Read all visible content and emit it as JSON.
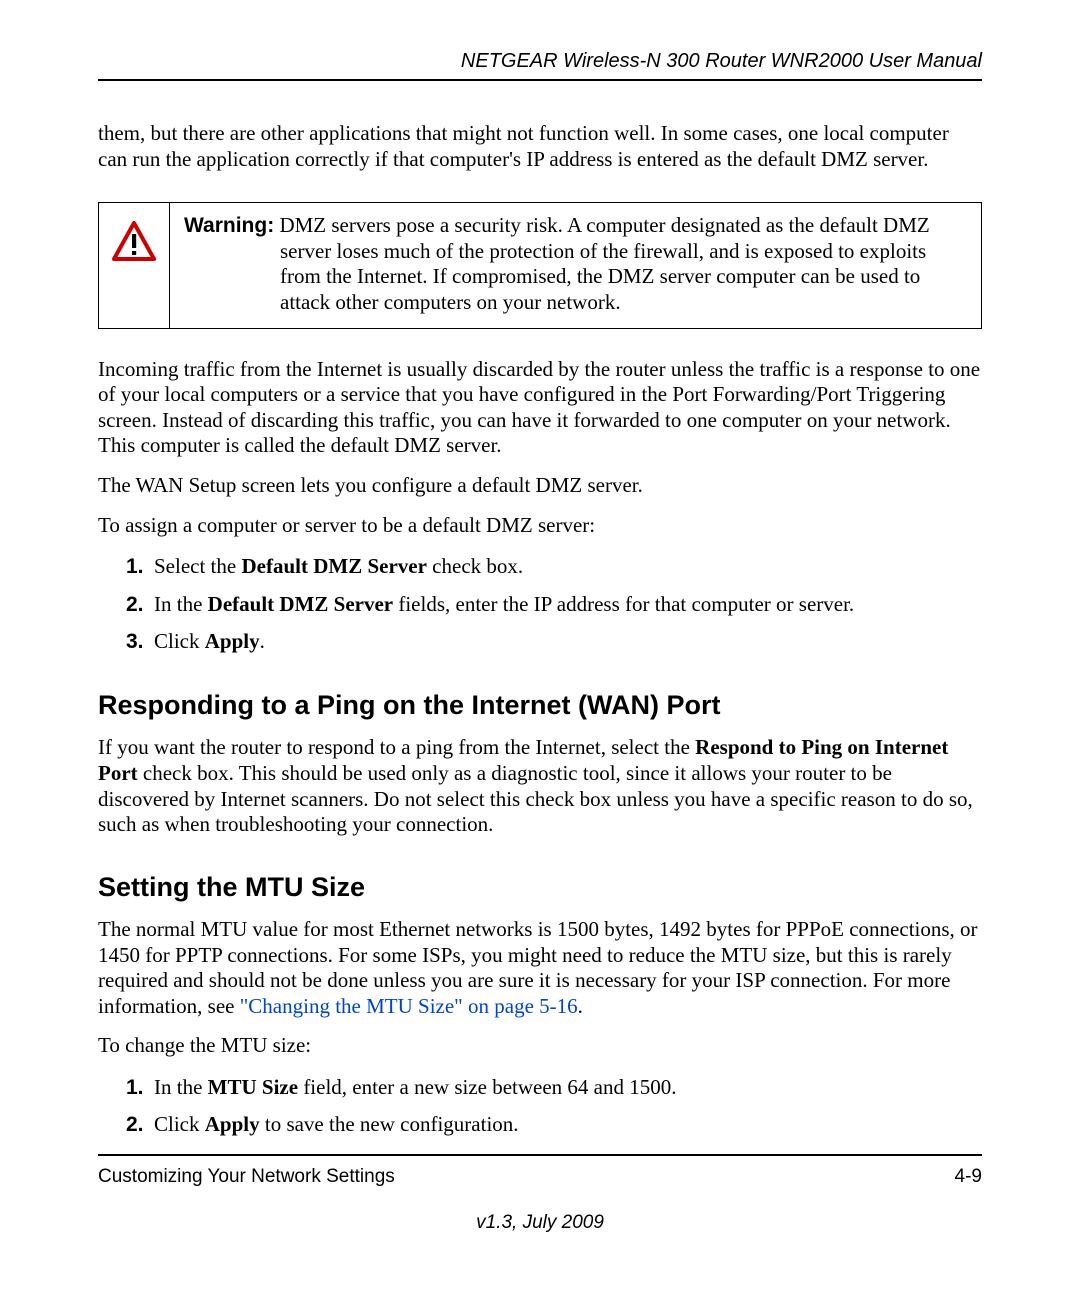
{
  "header": {
    "title": "NETGEAR Wireless-N 300 Router WNR2000 User Manual"
  },
  "intro_fragment": "them, but there are other applications that might not function well. In some cases, one local computer can run the application correctly if that computer's IP address is entered as the default DMZ server.",
  "warning": {
    "label": "Warning:",
    "line1": " DMZ servers pose a security risk. A computer designated as the default DMZ",
    "rest": "server loses much of the protection of the firewall, and is exposed to exploits from the Internet. If compromised, the DMZ server computer can be used to attack other computers on your network."
  },
  "para2": "Incoming traffic from the Internet is usually discarded by the router unless the traffic is a response to one of your local computers or a service that you have configured in the Port Forwarding/Port Triggering screen. Instead of discarding this traffic, you can have it forwarded to one computer on your network. This computer is called the default DMZ server.",
  "para3": "The WAN Setup screen lets you configure a default DMZ server.",
  "para4": "To assign a computer or server to be a default DMZ server:",
  "dmz_steps": {
    "n1": "1.",
    "s1a": "Select the ",
    "s1b": "Default DMZ Server",
    "s1c": " check box.",
    "n2": "2.",
    "s2a": "In the ",
    "s2b": "Default DMZ Server",
    "s2c": " fields, enter the IP address for that computer or server.",
    "n3": "3.",
    "s3a": "Click ",
    "s3b": "Apply",
    "s3c": "."
  },
  "section_ping": {
    "title": "Responding to a Ping on the Internet (WAN) Port",
    "p_a": "If you want the router to respond to a ping from the Internet, select the ",
    "p_b": "Respond to Ping on Internet Port",
    "p_c": " check box. This should be used only as a diagnostic tool, since it allows your router to be discovered by Internet scanners. Do not select this check box unless you have a specific reason to do so, such as when troubleshooting your connection."
  },
  "section_mtu": {
    "title": "Setting the MTU Size",
    "p_a": "The normal MTU value for most Ethernet networks is 1500 bytes, 1492 bytes for PPPoE connections, or 1450 for PPTP connections. For some ISPs, you might need to reduce the MTU size, but this is rarely required and should not be done unless you are sure it is necessary for your ISP connection. For more information, see ",
    "p_link": "\"Changing the MTU Size\" on page 5-16",
    "p_c": ".",
    "p2": "To change the MTU size:"
  },
  "mtu_steps": {
    "n1": "1.",
    "s1a": "In the ",
    "s1b": "MTU Size",
    "s1c": " field, enter a new size between 64 and 1500.",
    "n2": "2.",
    "s2a": "Click ",
    "s2b": "Apply",
    "s2c": " to save the new configuration."
  },
  "footer": {
    "section": "Customizing Your Network Settings",
    "page": "4-9",
    "version": "v1.3, July 2009"
  }
}
